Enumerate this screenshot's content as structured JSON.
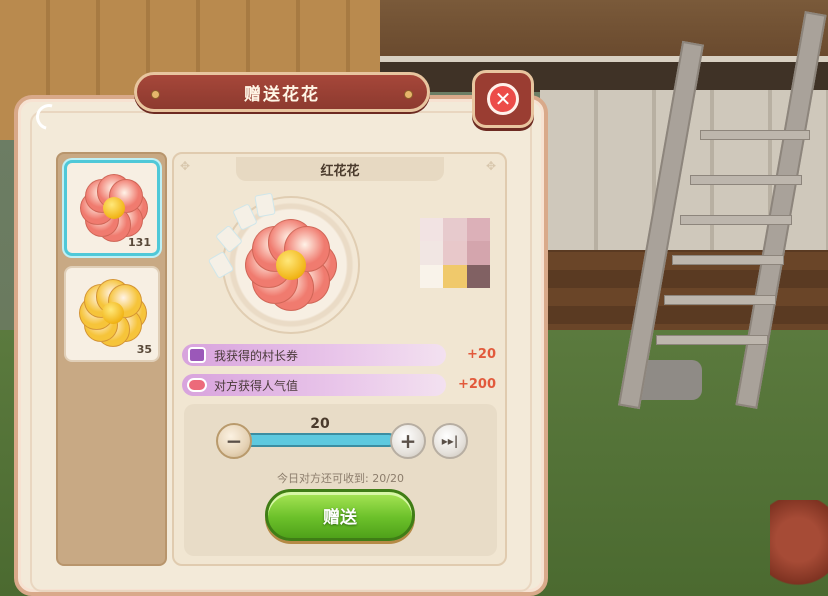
{
  "dialog": {
    "title": "赠送花花",
    "close_icon": "close-icon"
  },
  "flower_list": [
    {
      "name": "red-flower",
      "count": "131",
      "selected": true,
      "color": "#f07b6f"
    },
    {
      "name": "yellow-flower",
      "count": "35",
      "selected": false,
      "color": "#f6c43a"
    }
  ],
  "detail": {
    "flower_name": "红花花",
    "rewards": [
      {
        "icon": "voucher-icon",
        "label": "我获得的村长券",
        "value": "+20"
      },
      {
        "icon": "paw-icon",
        "label": "对方获得人气值",
        "value": "+200"
      }
    ]
  },
  "quantity": {
    "value": "20",
    "slider_fraction": 1.0,
    "minus_label": "−",
    "plus_label": "+",
    "max_label": "▸▸|"
  },
  "daily_limit": "今日对方还可收到: 20/20",
  "gift_button": "赠送",
  "colors": {
    "accent_banner": "#a6473a",
    "slider": "#5ec9df",
    "gift_button": "#6cc12a",
    "reward_value": "#e25a3c"
  }
}
